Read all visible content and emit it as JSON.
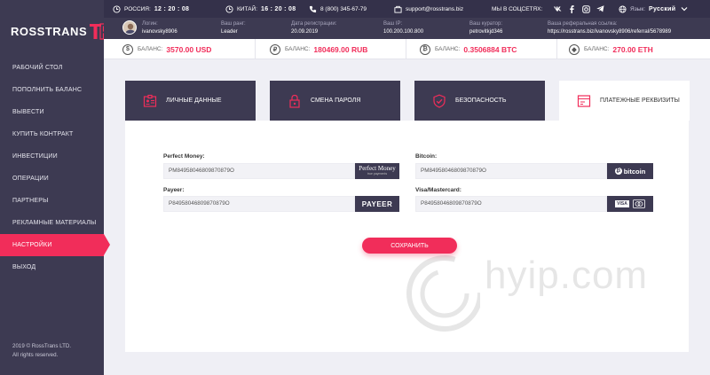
{
  "logo": {
    "text": "ROSSTRANS"
  },
  "sidebar": {
    "items": [
      {
        "label": "Рабочий стол"
      },
      {
        "label": "Пополнить баланс"
      },
      {
        "label": "Вывести"
      },
      {
        "label": "Купить контракт"
      },
      {
        "label": "Инвестиции"
      },
      {
        "label": "Операции"
      },
      {
        "label": "Партнеры"
      },
      {
        "label": "Рекламные материалы"
      },
      {
        "label": "Настройки"
      },
      {
        "label": "Выход"
      }
    ],
    "active_index": 8,
    "copyright_line1": "2019 © RossTrans LTD.",
    "copyright_line2": "All rights reserved."
  },
  "topbar": {
    "russia_label": "РОССИЯ:",
    "russia_time": "12 : 20 : 08",
    "china_label": "КИТАЙ:",
    "china_time": "16 : 20 : 08",
    "phone": "8 (800) 345-67-79",
    "email": "support@rosstrans.biz",
    "social_label": "МЫ В СОЦСЕТЯХ:",
    "language_label": "Язык:",
    "language_value": "Русский"
  },
  "user_info": {
    "login_label": "Логин:",
    "login_value": "ivanovsky8906",
    "rank_label": "Ваш ранг:",
    "rank_value": "Leader",
    "reg_label": "Дата регистрации:",
    "reg_value": "20.09.2019",
    "ip_label": "Ваш IP:",
    "ip_value": "100.200.100.800",
    "curator_label": "Ваш куратор:",
    "curator_value": "petrovitkjd346",
    "ref_label": "Ваша реферальная ссылка:",
    "ref_value": "https://rosstrans.biz/ivanovsky8906/referral/5678989"
  },
  "balances": [
    {
      "label": "БАЛАНС:",
      "amount": "3570.00 USD",
      "icon": "dollar-coin-icon",
      "symbol": "$"
    },
    {
      "label": "БАЛАНС:",
      "amount": "180469.00 RUB",
      "icon": "ruble-coin-icon",
      "symbol": "₽"
    },
    {
      "label": "БАЛАНС:",
      "amount": "0.3506884 BTC",
      "icon": "bitcoin-coin-icon",
      "symbol": "₿"
    },
    {
      "label": "БАЛАНС:",
      "amount": "270.00 ETH",
      "icon": "ethereum-coin-icon",
      "symbol": "◆"
    }
  ],
  "tabs": [
    {
      "label": "Личные данные",
      "icon": "id-card-icon"
    },
    {
      "label": "Смена пароля",
      "icon": "lock-icon"
    },
    {
      "label": "Безопасность",
      "icon": "shield-icon"
    },
    {
      "label": "Платежные реквизиты",
      "icon": "card-icon"
    }
  ],
  "active_tab": 3,
  "form": {
    "perfect_money_label": "Perfect Money:",
    "perfect_money_value": "PM84958046809870879O",
    "perfect_money_brand": "Perfect Money",
    "perfect_money_brand_sub": "true payments",
    "payeer_label": "Payeer:",
    "payeer_value": "P84958046809870879O",
    "payeer_brand": "PAYEER",
    "bitcoin_label": "Bitcoin:",
    "bitcoin_value": "PM84958046809870879O",
    "bitcoin_brand": "bitcoin",
    "visa_label": "Visa/Mastercard:",
    "visa_value": "P84958046809870879O",
    "visa_brand": "VISA",
    "save_label": "Сохранить"
  },
  "watermark": {
    "text": "hyip.com"
  },
  "colors": {
    "accent": "#f12d5a",
    "dark": "#3d3a52",
    "darker": "#34314a",
    "background": "#efeff5"
  }
}
